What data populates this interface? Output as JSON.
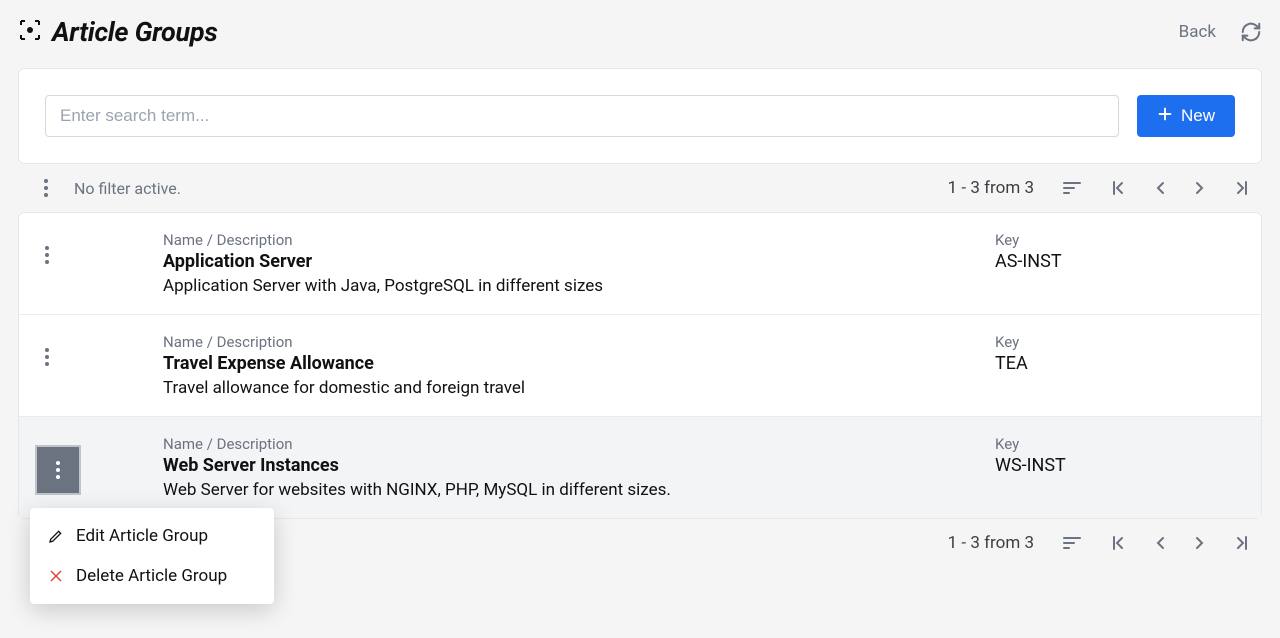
{
  "header": {
    "title": "Article Groups",
    "back_label": "Back"
  },
  "search": {
    "placeholder": "Enter search term...",
    "new_label": "New"
  },
  "toolbar": {
    "filter_status": "No filter active.",
    "range_text": "1 - 3 from 3"
  },
  "columns": {
    "name_label": "Name / Description",
    "key_label": "Key"
  },
  "rows": [
    {
      "name": "Application Server",
      "desc": "Application Server with Java, PostgreSQL in different sizes",
      "key": "AS-INST",
      "active": false
    },
    {
      "name": "Travel Expense Allowance",
      "desc": "Travel allowance for domestic and foreign travel",
      "key": "TEA",
      "active": false
    },
    {
      "name": "Web Server Instances",
      "desc": "Web Server for websites with NGINX, PHP, MySQL in different sizes.",
      "key": "WS-INST",
      "active": true
    }
  ],
  "context_menu": {
    "edit_label": "Edit Article Group",
    "delete_label": "Delete Article Group"
  }
}
